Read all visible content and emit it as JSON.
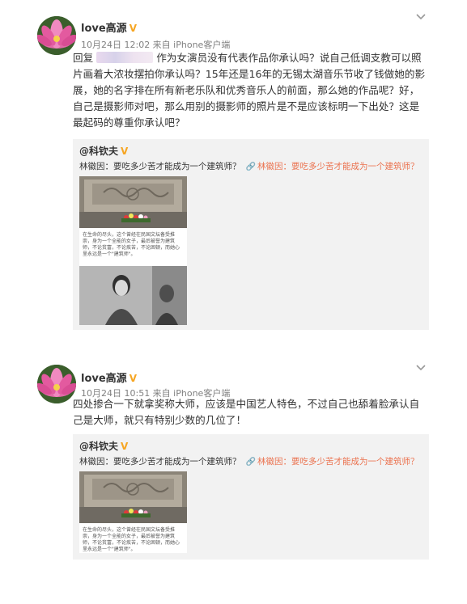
{
  "posts": [
    {
      "user": "love高源",
      "vip": "V",
      "meta": "10月24日 12:02 来自 iPhone客户端",
      "reply_prefix": "回复",
      "text": "作为女演员没有代表作品你承认吗？说自己低调支教可以照片画着大浓妆摆拍你承认吗？15年还是16年的无锡太湖音乐节收了钱做她的影展，她的名字排在所有新老乐队和优秀音乐人的前面，那么她的作品呢？好，自己是摄影师对吧，那么用别的摄影师的照片是不是应该标明一下出处？这是最起码的尊重你承认吧？",
      "repost": {
        "user": "@科钦夫",
        "text": "林徽因：要吃多少苦才能成为一个建筑师？",
        "link": "林徽因：要吃多少苦才能成为一个建筑师？",
        "caption": "在生命的尽头，这个曾经在民国文坛备受推崇，身为一个全能的女子，最后被誉为建筑师，不论贫富，不论疾苦，不论困顿，而她心里永远是一个\"建筑师\"。"
      }
    },
    {
      "user": "love高源",
      "vip": "V",
      "meta": "10月24日 10:51 来自 iPhone客户端",
      "text": "四处掺合一下就拿奖称大师，应该是中国艺人特色，不过自己也舔着脸承认自己是大师，就只有特别少数的几位了！",
      "repost": {
        "user": "@科钦夫",
        "text": "林徽因：要吃多少苦才能成为一个建筑师？",
        "link": "林徽因：要吃多少苦才能成为一个建筑师？",
        "caption": "在生命的尽头，这个曾经在民国文坛备受推崇，身为一个全能的女子，最后被誉为建筑师，不论贫富，不论疾苦，不论困顿，而她心里永远是一个\"建筑师\"。"
      }
    }
  ],
  "colors": {
    "link": "#eb7350",
    "vip": "#f6a623",
    "repost_bg": "#f2f2f2"
  }
}
